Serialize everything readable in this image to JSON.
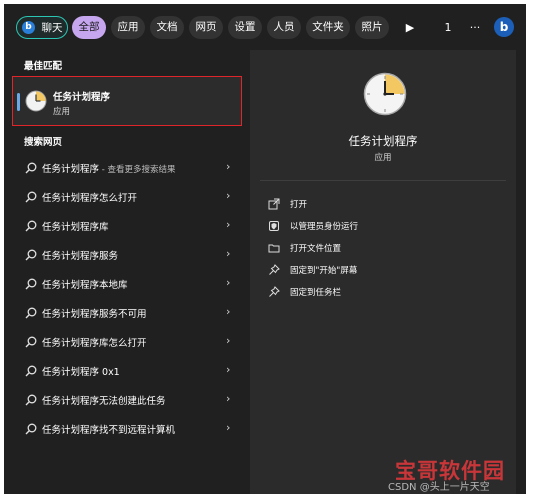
{
  "topbar": {
    "chat_label": "聊天",
    "filters": [
      "全部",
      "应用",
      "文档",
      "网页",
      "设置",
      "人员",
      "文件夹",
      "照片"
    ],
    "count": "1",
    "more": "···"
  },
  "left": {
    "best_match_title": "最佳匹配",
    "best_match": {
      "name": "任务计划程序",
      "type": "应用"
    },
    "web_title": "搜索网页",
    "web_items": [
      {
        "text": "任务计划程序",
        "hint": " - 查看更多搜索结果"
      },
      {
        "text": "任务计划程序怎么打开",
        "hint": ""
      },
      {
        "text": "任务计划程序库",
        "hint": ""
      },
      {
        "text": "任务计划程序服务",
        "hint": ""
      },
      {
        "text": "任务计划程序本地库",
        "hint": ""
      },
      {
        "text": "任务计划程序服务不可用",
        "hint": ""
      },
      {
        "text": "任务计划程序库怎么打开",
        "hint": ""
      },
      {
        "text": "任务计划程序 0x1",
        "hint": ""
      },
      {
        "text": "任务计划程序无法创建此任务",
        "hint": ""
      },
      {
        "text": "任务计划程序找不到远程计算机",
        "hint": ""
      }
    ]
  },
  "right": {
    "app_name": "任务计划程序",
    "app_type": "应用",
    "actions": [
      {
        "label": "打开",
        "icon": "open-icon"
      },
      {
        "label": "以管理员身份运行",
        "icon": "shield-icon"
      },
      {
        "label": "打开文件位置",
        "icon": "folder-icon"
      },
      {
        "label": "固定到\"开始\"屏幕",
        "icon": "pin-icon"
      },
      {
        "label": "固定到任务栏",
        "icon": "pin-icon"
      }
    ]
  },
  "watermark": {
    "brand": "宝哥软件园",
    "caption": "CSDN @头上一片天空"
  },
  "colors": {
    "accent_chat": "#2bc6b4",
    "accent_all": "#c7a6f0",
    "highlight_border": "#e0252a"
  }
}
